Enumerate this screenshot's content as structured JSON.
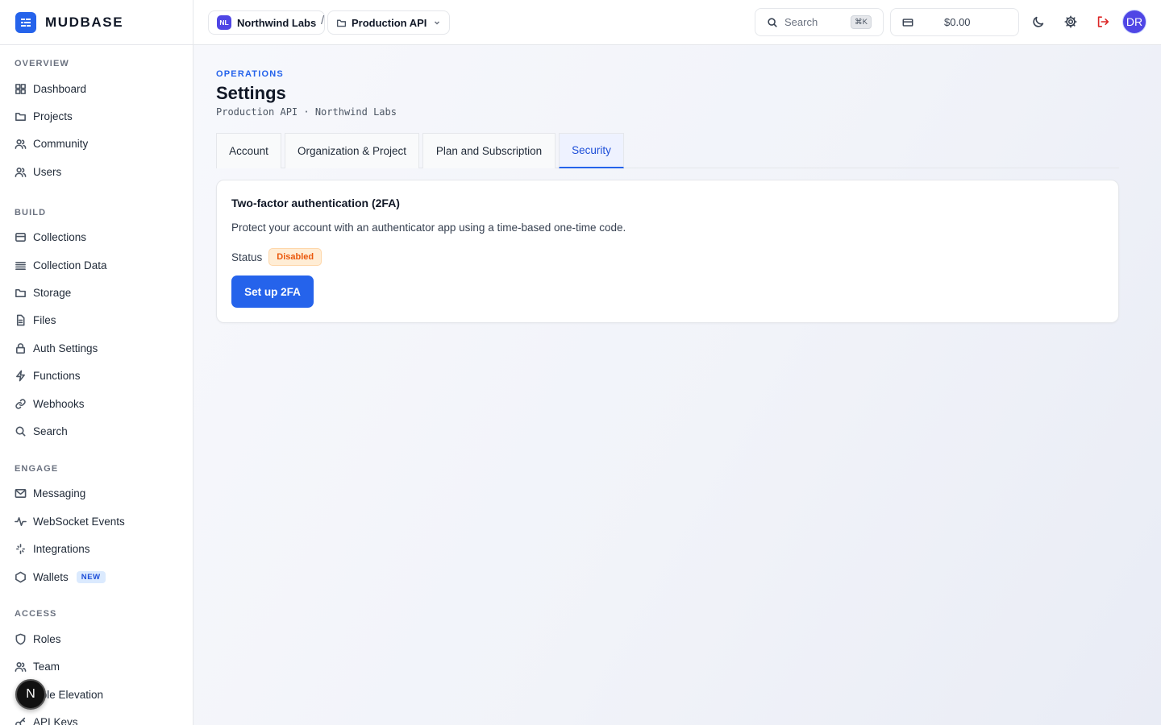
{
  "app": {
    "name": "MUDBASE"
  },
  "sidebar": {
    "sections": [
      {
        "label": "OVERVIEW",
        "items": [
          {
            "label": "Dashboard",
            "icon": "grid-icon"
          },
          {
            "label": "Projects",
            "icon": "folder-icon"
          },
          {
            "label": "Community",
            "icon": "users-icon"
          },
          {
            "label": "Users",
            "icon": "user-group-icon"
          }
        ]
      },
      {
        "label": "BUILD",
        "items": [
          {
            "label": "Collections",
            "icon": "database-icon"
          },
          {
            "label": "Collection Data",
            "icon": "list-icon"
          },
          {
            "label": "Storage",
            "icon": "folder-icon"
          },
          {
            "label": "Files",
            "icon": "file-icon"
          },
          {
            "label": "Auth Settings",
            "icon": "lock-icon"
          },
          {
            "label": "Functions",
            "icon": "bolt-icon"
          },
          {
            "label": "Webhooks",
            "icon": "link-icon"
          },
          {
            "label": "Search",
            "icon": "search-icon"
          }
        ]
      },
      {
        "label": "ENGAGE",
        "items": [
          {
            "label": "Messaging",
            "icon": "mail-icon"
          },
          {
            "label": "WebSocket Events",
            "icon": "activity-icon"
          },
          {
            "label": "Integrations",
            "icon": "sparkle-icon"
          },
          {
            "label": "Wallets",
            "icon": "hexagon-icon",
            "badge": "NEW"
          }
        ]
      },
      {
        "label": "ACCESS",
        "items": [
          {
            "label": "Roles",
            "icon": "shield-icon"
          },
          {
            "label": "Team",
            "icon": "users-icon"
          },
          {
            "label": "Role Elevation",
            "icon": "arrow-up-icon"
          },
          {
            "label": "API Keys",
            "icon": "key-icon"
          }
        ]
      }
    ],
    "floating_button": "N"
  },
  "topbar": {
    "org": {
      "initials": "NL",
      "name": "Northwind Labs"
    },
    "separator": "/",
    "project": {
      "name": "Production API"
    },
    "search": {
      "placeholder": "Search",
      "shortcut": "⌘K"
    },
    "credits": {
      "amount": "$0.00"
    },
    "user": {
      "initials": "DR"
    }
  },
  "page": {
    "eyebrow": "OPERATIONS",
    "title": "Settings",
    "subtitle": "Production API · Northwind Labs",
    "tabs": [
      {
        "label": "Account"
      },
      {
        "label": "Organization & Project"
      },
      {
        "label": "Plan and Subscription"
      },
      {
        "label": "Security",
        "active": true
      }
    ],
    "card": {
      "title": "Two-factor authentication (2FA)",
      "description": "Protect your account with an authenticator app using a time-based one-time code.",
      "status_label": "Status",
      "status_value": "Disabled",
      "button_label": "Set up 2FA"
    }
  },
  "colors": {
    "accent": "#2563eb",
    "danger": "#dc2626",
    "warning_text": "#ea580c",
    "warning_bg": "#ffedd5"
  }
}
